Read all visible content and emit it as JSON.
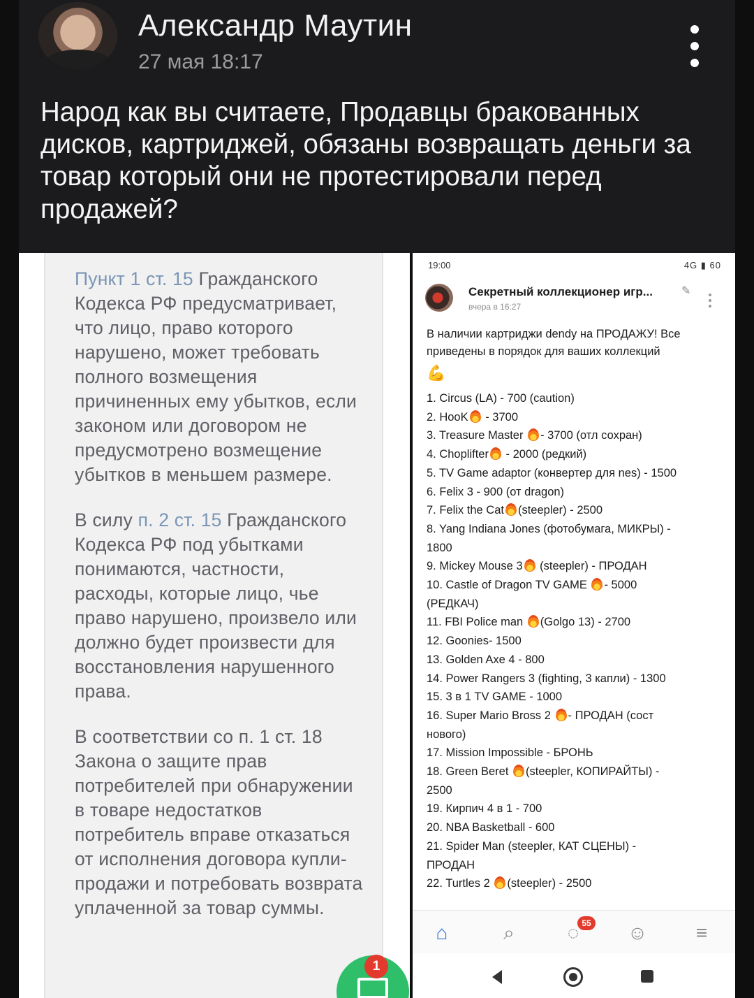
{
  "post": {
    "author": "Александр Маутин",
    "date": "27 мая 18:17",
    "text": "Народ как вы считаете, Продавцы бракованных дисков, картриджей, обязаны возвращать деньги за товар который они не протестировали перед продажей?"
  },
  "left_screenshot": {
    "p1_link": "Пункт 1 ст. 15",
    "p1_text": " Гражданского Кодекса РФ предусматривает, что лицо, право которого нарушено, может требовать полного возмещения причиненных ему убытков, если законом или договором не предусмотрено возмещение убытков в меньшем размере.",
    "p2_pre": "В силу ",
    "p2_link": "п. 2 ст. 15",
    "p2_text": " Гражданского Кодекса РФ под убытками понимаются, частности, расходы, которые лицо, чье право нарушено, произвело или должно будет произвести для восстановления нарушенного права.",
    "p3_text": "В соответствии со п. 1 ст. 18 Закона о защите прав потребителей при обнаружении в товаре недостатков потребитель вправе отказаться от исполнения договора купли-продажи и потребовать возврата уплаченной за товар суммы.",
    "fab_badge": "1",
    "fab_icon": "envelope-icon"
  },
  "right_screenshot": {
    "status_time": "19:00",
    "status_right": "4G ▮ 60",
    "group_name": "Секретный коллекционер игр...",
    "group_time": "вчера в 16:27",
    "intro": "В наличии картриджи dendy на ПРОДАЖУ! Все приведены в порядок для ваших коллекций",
    "items": [
      {
        "pre": "1. Circus (LA) - 700 (caution)",
        "fire": false,
        "post": ""
      },
      {
        "pre": "2. HooK",
        "fire": true,
        "post": " - 3700"
      },
      {
        "pre": "3. Treasure Master ",
        "fire": true,
        "post": "- 3700 (отл сохран)"
      },
      {
        "pre": "4. Choplifter",
        "fire": true,
        "post": " - 2000 (редкий)"
      },
      {
        "pre": "5. TV Game adaptor (конвертер для nes) -  1500",
        "fire": false,
        "post": ""
      },
      {
        "pre": "6. Felix 3 - 900 (от dragon)",
        "fire": false,
        "post": ""
      },
      {
        "pre": "7. Felix the Cat",
        "fire": true,
        "post": "(steepler) - 2500"
      },
      {
        "pre": "8. Yang Indiana Jones (фотобумага, МИКРЫ) -",
        "fire": false,
        "post": ""
      },
      {
        "pre": "1800",
        "fire": false,
        "post": ""
      },
      {
        "pre": "9. Mickey Mouse 3",
        "fire": true,
        "post": " (steepler) - ПРОДАН"
      },
      {
        "pre": "10. Castle of Dragon TV GAME ",
        "fire": true,
        "post": "- 5000"
      },
      {
        "pre": "(РЕДКАЧ)",
        "fire": false,
        "post": ""
      },
      {
        "pre": "11. FBI Police man ",
        "fire": true,
        "post": "(Golgo 13) - 2700"
      },
      {
        "pre": "12. Goonies- 1500",
        "fire": false,
        "post": ""
      },
      {
        "pre": "13. Golden Axe 4 - 800",
        "fire": false,
        "post": ""
      },
      {
        "pre": "14. Power Rangers 3 (fighting, 3 капли) - 1300",
        "fire": false,
        "post": ""
      },
      {
        "pre": "15. 3 в 1 TV GAME - 1000",
        "fire": false,
        "post": ""
      },
      {
        "pre": "16. Super Mario Bross 2 ",
        "fire": true,
        "post": "- ПРОДАН (сост"
      },
      {
        "pre": "нового)",
        "fire": false,
        "post": ""
      },
      {
        "pre": "17. Mission Impossible - БРОНЬ",
        "fire": false,
        "post": ""
      },
      {
        "pre": "18. Green Beret ",
        "fire": true,
        "post": "(steepler, КОПИРАЙТЫ) -"
      },
      {
        "pre": "2500",
        "fire": false,
        "post": ""
      },
      {
        "pre": "19. Кирпич 4 в 1 - 700",
        "fire": false,
        "post": ""
      },
      {
        "pre": "20. NBA Basketball - 600",
        "fire": false,
        "post": ""
      },
      {
        "pre": "21. Spider Man (steepler, КАТ СЦЕНЫ) -",
        "fire": false,
        "post": ""
      },
      {
        "pre": "ПРОДАН",
        "fire": false,
        "post": ""
      },
      {
        "pre": "22. Turtles 2 ",
        "fire": true,
        "post": "(steepler) - 2500"
      }
    ],
    "tabs": [
      "home-icon",
      "search-icon",
      "messages-icon",
      "notifications-icon",
      "menu-icon"
    ],
    "messages_badge": "55",
    "nav": [
      "back-icon",
      "home-button-icon",
      "recents-icon"
    ]
  }
}
